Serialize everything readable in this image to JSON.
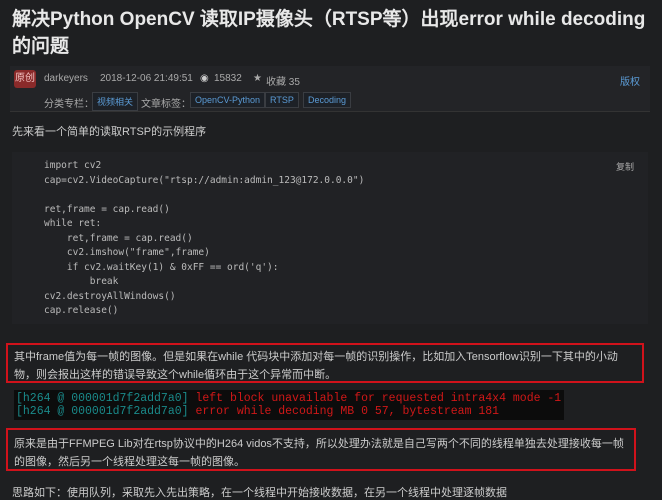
{
  "title": "解决Python OpenCV 读取IP摄像头（RTSP等）出现error while decoding的问题",
  "meta": {
    "badge": "原创",
    "author": "darkeyers",
    "date": "2018-12-06 21:49:51",
    "views": "15832",
    "favorites": "收藏 35",
    "copyright": "版权",
    "category_label": "分类专栏：",
    "category": "视频相关",
    "tags_label": "文章标签：",
    "tags": [
      "OpenCV-Python",
      "RTSP",
      "Decoding"
    ]
  },
  "intro": "先来看一个简单的读取RTSP的示例程序",
  "code": {
    "copy": "复制",
    "lines": [
      "import cv2",
      "cap=cv2.VideoCapture(\"rtsp://admin:admin_123@172.0.0.0\")",
      "",
      "ret,frame = cap.read()",
      "while ret:",
      "    ret,frame = cap.read()",
      "    cv2.imshow(\"frame\",frame)",
      "    if cv2.waitKey(1) & 0xFF == ord('q'):",
      "        break",
      "cv2.destroyAllWindows()",
      "cap.release()"
    ]
  },
  "para1": "其中frame值为每一帧的图像。但是如果在while 代码块中添加对每一帧的识别操作，比如加入Tensorflow识别一下其中的小动物，则会报出这样的错误导致这个while循环由于这个异常而中断。",
  "terminal": [
    {
      "prefix": "[h264 @ 000001d7f2add7a0]",
      "msg": "left block unavailable for requested intra4x4 mode -1"
    },
    {
      "prefix": "[h264 @ 000001d7f2add7a0]",
      "msg": "error while decoding MB 0 57, bytestream 181"
    }
  ],
  "para2": "原来是由于FFMPEG Lib对在rtsp协议中的H264 vidos不支持，所以处理办法就是自己写两个不同的线程单独去处理接收每一帧的图像，然后另一个线程处理这每一帧的图像。",
  "para3": "思路如下：使用队列，采取先入先出策略，在一个线程中开始接收数据，在另一个线程中处理逐帧数据"
}
